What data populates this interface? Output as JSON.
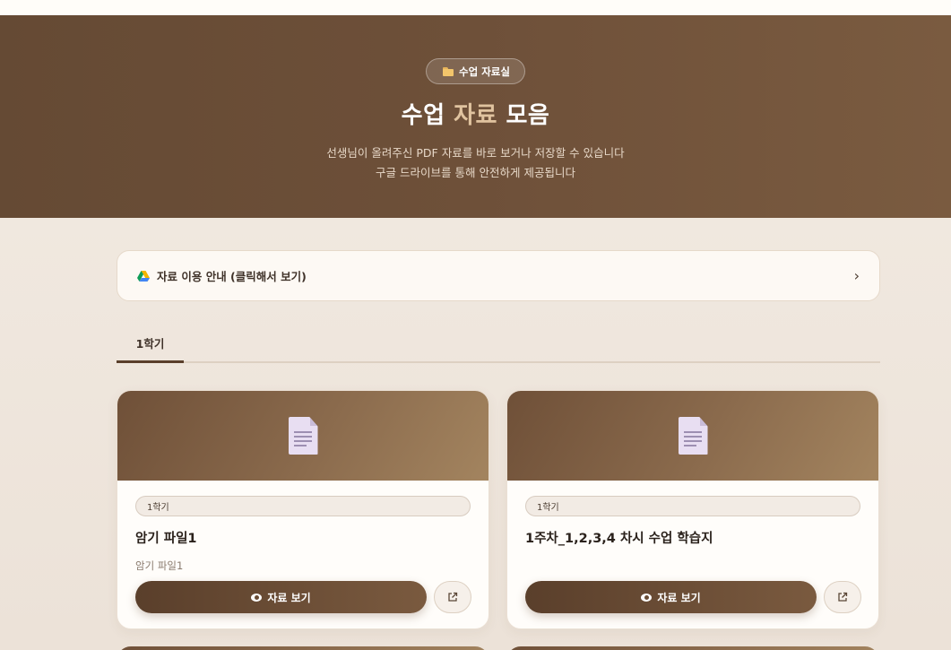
{
  "hero": {
    "badge": "수업 자료실",
    "title_part1": "수업",
    "title_accent": "자료",
    "title_part2": "모음",
    "subtitle_line1": "선생님이 올려주신 PDF 자료를 바로 보거나 저장할 수 있습니다",
    "subtitle_line2": "구글 드라이브를 통해 안전하게 제공됩니다"
  },
  "guide": {
    "label": "자료 이용 안내 (클릭해서 보기)"
  },
  "tabs": [
    {
      "label": "1학기",
      "active": true
    }
  ],
  "cards": [
    {
      "semester": "1학기",
      "title": "암기 파일1",
      "description": "암기 파일1",
      "view_label": "자료 보기"
    },
    {
      "semester": "1학기",
      "title": "1주차_1,2,3,4 차시 수업 학습지",
      "description": "",
      "view_label": "자료 보기"
    }
  ],
  "icons": {
    "badge": "folder-icon",
    "guide": "google-drive-icon",
    "guide_arrow": "chevron-right-icon",
    "thumbnail": "document-icon",
    "view": "eye-icon",
    "external": "external-link-icon"
  },
  "colors": {
    "hero_bg": "#6e5039",
    "accent": "#e0c39f",
    "primary_button": "#5a3f2b",
    "page_bg": "#efe6dd"
  }
}
